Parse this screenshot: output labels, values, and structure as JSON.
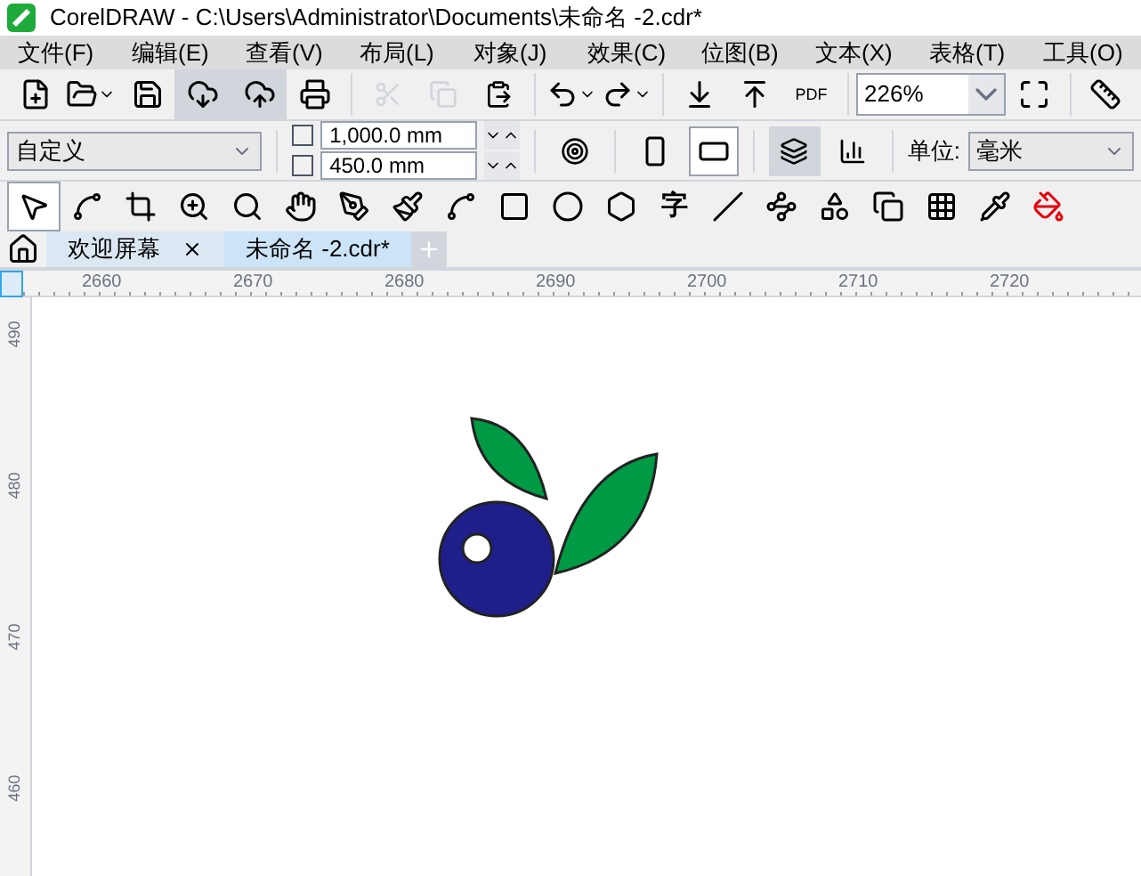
{
  "window": {
    "title": "CorelDRAW - C:\\Users\\Administrator\\Documents\\未命名 -2.cdr*"
  },
  "menu": [
    {
      "label": "文件(F)"
    },
    {
      "label": "编辑(E)"
    },
    {
      "label": "查看(V)"
    },
    {
      "label": "布局(L)"
    },
    {
      "label": "对象(J)"
    },
    {
      "label": "效果(C)"
    },
    {
      "label": "位图(B)"
    },
    {
      "label": "文本(X)"
    },
    {
      "label": "表格(T)"
    },
    {
      "label": "工具(O)"
    }
  ],
  "toolbar": {
    "pdf_label": "PDF",
    "zoom": "226%"
  },
  "property_bar": {
    "page_size": "自定义",
    "width": "1,000.0 mm",
    "height": "450.0 mm",
    "orientation": [
      {
        "kind": "portrait",
        "selected": false
      },
      {
        "kind": "landscape",
        "selected": true
      }
    ],
    "unit_label": "单位:",
    "unit": "毫米"
  },
  "tools": [
    {
      "kind": "pick",
      "selected": true
    },
    {
      "kind": "shape",
      "selected": false
    },
    {
      "kind": "crop",
      "selected": false
    },
    {
      "kind": "zoom",
      "selected": false
    },
    {
      "kind": "search",
      "selected": false
    },
    {
      "kind": "pan",
      "selected": false
    },
    {
      "kind": "pen",
      "selected": false
    },
    {
      "kind": "brush",
      "selected": false
    },
    {
      "kind": "curve",
      "selected": false
    },
    {
      "kind": "rect",
      "selected": false
    },
    {
      "kind": "ellipse",
      "selected": false
    },
    {
      "kind": "polygon",
      "selected": false
    },
    {
      "kind": "text",
      "label": "字",
      "selected": false
    },
    {
      "kind": "line",
      "selected": false
    },
    {
      "kind": "connector",
      "selected": false
    },
    {
      "kind": "blend",
      "selected": false
    },
    {
      "kind": "shadow",
      "selected": false
    },
    {
      "kind": "transparency",
      "selected": false
    },
    {
      "kind": "eyedropper",
      "selected": false
    },
    {
      "kind": "fill",
      "selected": false
    }
  ],
  "tabs": [
    {
      "label": "欢迎屏幕",
      "selected": false
    },
    {
      "label": "未命名 -2.cdr*",
      "selected": true
    }
  ],
  "rulers": {
    "horizontal": [
      "2660",
      "2670",
      "2680",
      "2690",
      "2700",
      "2710",
      "2720"
    ],
    "vertical": [
      "490",
      "480",
      "470",
      "460"
    ]
  }
}
